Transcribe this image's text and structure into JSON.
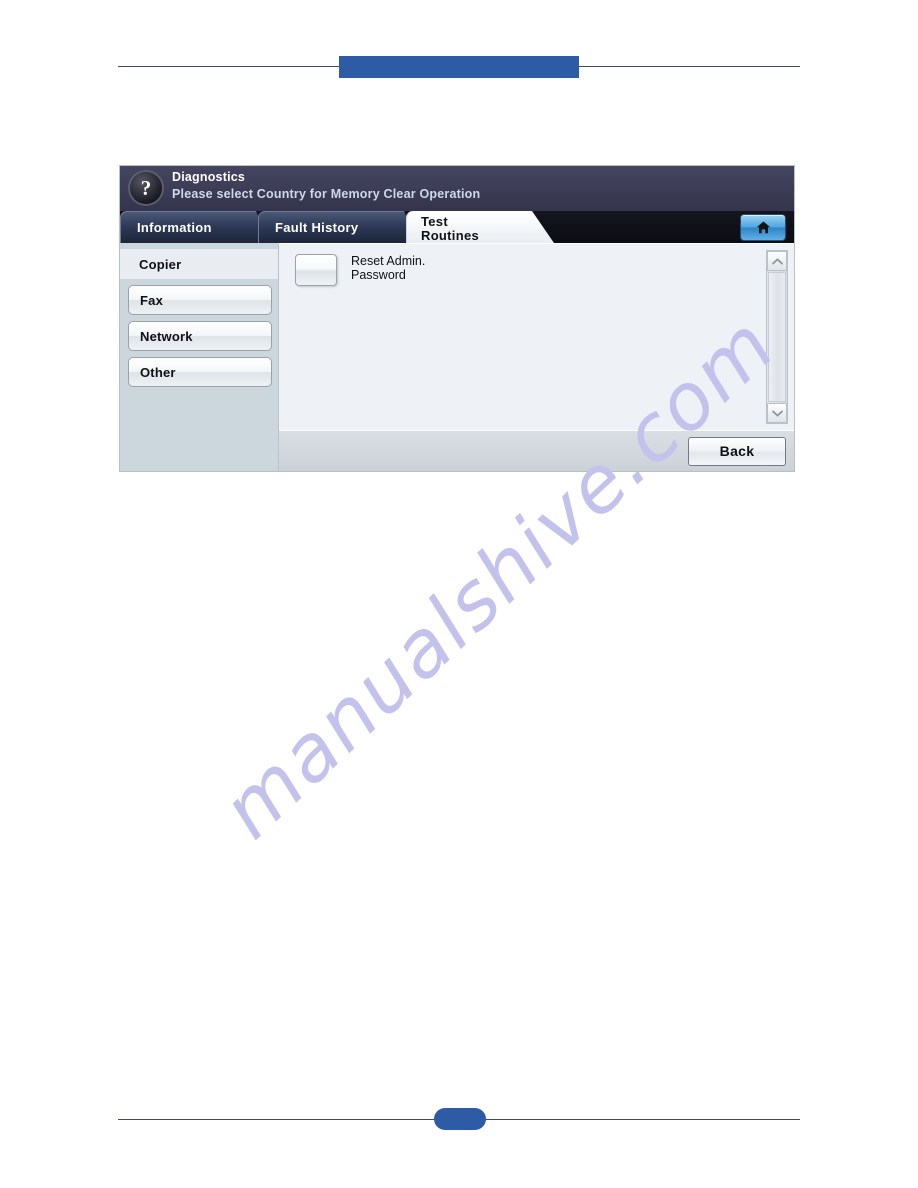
{
  "page": {
    "watermark": "manualshive.com",
    "accent_blue": "#2e5ba6",
    "rule_color": "#3c4a6b"
  },
  "panel": {
    "header": {
      "help_icon": "question-mark-icon",
      "title": "Diagnostics",
      "subtitle": "Please select Country for Memory Clear Operation"
    },
    "tabs": [
      {
        "label": "Information",
        "active": false
      },
      {
        "label": "Fault History",
        "active": false
      },
      {
        "label_line1": "Test",
        "label_line2": "Routines",
        "active": true
      }
    ],
    "home_button": {
      "icon": "home-icon",
      "label": ""
    },
    "sidebar": {
      "items": [
        {
          "label": "Copier",
          "active": true
        },
        {
          "label": "Fax",
          "active": false
        },
        {
          "label": "Network",
          "active": false
        },
        {
          "label": "Other",
          "active": false
        }
      ]
    },
    "content": {
      "rows": [
        {
          "button_label": "",
          "label_line1": "Reset Admin.",
          "label_line2": "Password"
        }
      ],
      "scrollbar": {
        "up_icon": "chevron-up-icon",
        "down_icon": "chevron-down-icon"
      }
    },
    "footer": {
      "back_label": "Back"
    }
  }
}
